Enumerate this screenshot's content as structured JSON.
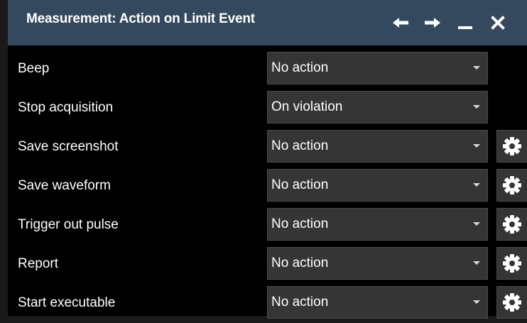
{
  "dialog": {
    "title": "Measurement: Action on Limit Event",
    "buttons": {
      "back": "left-arrow-icon",
      "forward": "right-arrow-icon",
      "minimize": "minimize-icon",
      "close": "close-icon"
    }
  },
  "colors": {
    "titlebar_bg": "#34495e",
    "dialog_bg": "#000000",
    "field_bg": "#353535",
    "text": "#ffffff"
  },
  "actions": [
    {
      "label": "Beep",
      "value": "No action",
      "has_settings": false
    },
    {
      "label": "Stop acquisition",
      "value": "On violation",
      "has_settings": false
    },
    {
      "label": "Save screenshot",
      "value": "No action",
      "has_settings": true
    },
    {
      "label": "Save waveform",
      "value": "No action",
      "has_settings": true
    },
    {
      "label": "Trigger out pulse",
      "value": "No action",
      "has_settings": true
    },
    {
      "label": "Report",
      "value": "No action",
      "has_settings": true
    },
    {
      "label": "Start executable",
      "value": "No action",
      "has_settings": true
    }
  ]
}
